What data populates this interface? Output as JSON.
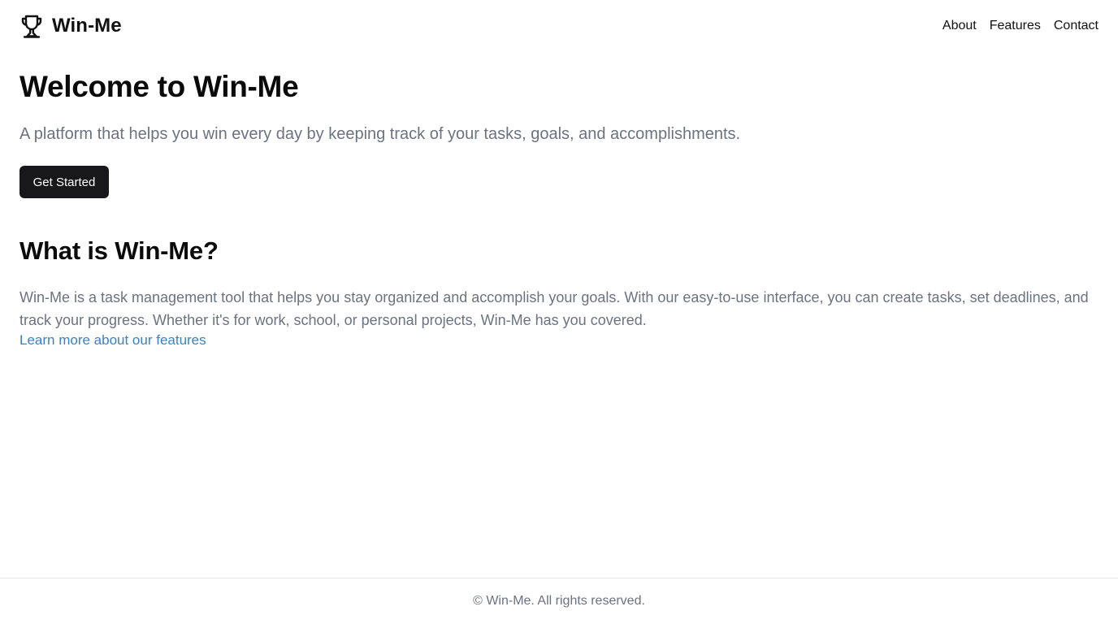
{
  "header": {
    "brand_icon": "trophy-icon",
    "brand_name": "Win-Me",
    "nav": {
      "about": "About",
      "features": "Features",
      "contact": "Contact"
    }
  },
  "hero": {
    "title": "Welcome to Win-Me",
    "subtitle": "A platform that helps you win every day by keeping track of your tasks, goals, and accomplishments.",
    "cta_label": "Get Started"
  },
  "about": {
    "title": "What is Win-Me?",
    "body": "Win-Me is a task management tool that helps you stay organized and accomplish your goals. With our easy-to-use interface, you can create tasks, set deadlines, and track your progress. Whether it's for work, school, or personal projects, Win-Me has you covered.",
    "link_label": "Learn more about our features"
  },
  "footer": {
    "text": "© Win-Me. All rights reserved."
  },
  "colors": {
    "button_bg": "#18181b",
    "muted_text": "#6b7280",
    "link": "#3b82c4"
  }
}
